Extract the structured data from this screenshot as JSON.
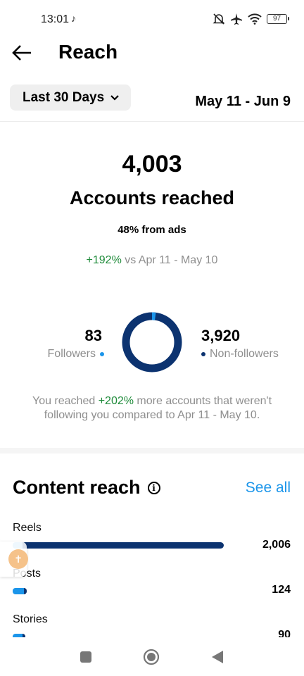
{
  "status": {
    "time": "13:01",
    "battery": "97"
  },
  "header": {
    "title": "Reach"
  },
  "filter": {
    "range_label": "Last 30 Days",
    "date_range": "May 11 - Jun 9"
  },
  "summary": {
    "accounts_reached": "4,003",
    "accounts_reached_label": "Accounts reached",
    "ads_line": "48% from ads",
    "change_pct": "+192%",
    "change_text": " vs Apr 11 - May 10"
  },
  "audience": {
    "followers_count": "83",
    "followers_label": "Followers",
    "nonfollowers_count": "3,920",
    "nonfollowers_label": "Non-followers",
    "followers_color": "#1b95ea",
    "nonfollowers_color": "#0c3370",
    "followers_fraction": 0.0207
  },
  "note": {
    "prefix": "You reached ",
    "pct": "+202%",
    "suffix": " more accounts that weren't following you compared to Apr 11 - May 10."
  },
  "content_reach": {
    "title": "Content reach",
    "see_all": "See all",
    "rows": [
      {
        "label": "Reels",
        "value": "2,006",
        "followers": 31,
        "nonfollowers": 1975
      },
      {
        "label": "Posts",
        "value": "124",
        "followers": 110,
        "nonfollowers": 14
      },
      {
        "label": "Stories",
        "value": "90",
        "followers": 78,
        "nonfollowers": 12
      }
    ]
  }
}
